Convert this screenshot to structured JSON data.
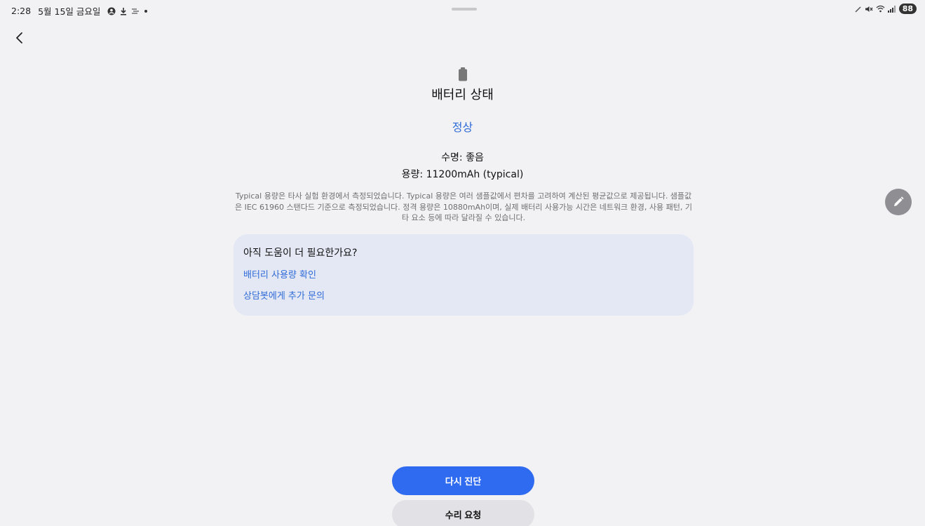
{
  "status_bar": {
    "time": "2:28",
    "date": "5월 15일 금요일",
    "battery_level": "88",
    "icons_left": [
      "account-icon",
      "download-icon",
      "weather-icon",
      "dot-icon"
    ],
    "icons_right": [
      "pen-icon",
      "mute-icon",
      "wifi-icon",
      "signal-icon"
    ]
  },
  "header": {
    "title": "배터리 상태",
    "status": "정상",
    "status_color": "#2f6ad8"
  },
  "details": {
    "lifespan": "수명: 좋음",
    "capacity": "용량: 11200mAh (typical)"
  },
  "disclaimer": "Typical 용량은 타사 실험 환경에서 측정되었습니다. Typical 용량은 여러 샘플값에서 편차를 고려하여 계산된 평균값으로 제공됩니다. 샘플값은 IEC 61960 스탠다드 기준으로 측정되었습니다. 정격 용량은 10880mAh이며, 실제 배터리 사용가능 시간은 네트워크 환경, 사용 패턴, 기타 요소 등에 따라 달라질 수 있습니다.",
  "help": {
    "title": "아직 도움이 더 필요한가요?",
    "links": [
      "배터리 사용량 확인",
      "상담봇에게 추가 문의"
    ],
    "link_color": "#2f6ad8"
  },
  "buttons": {
    "primary": "다시 진단",
    "secondary": "수리 요청",
    "primary_color": "#2f6bf0"
  }
}
